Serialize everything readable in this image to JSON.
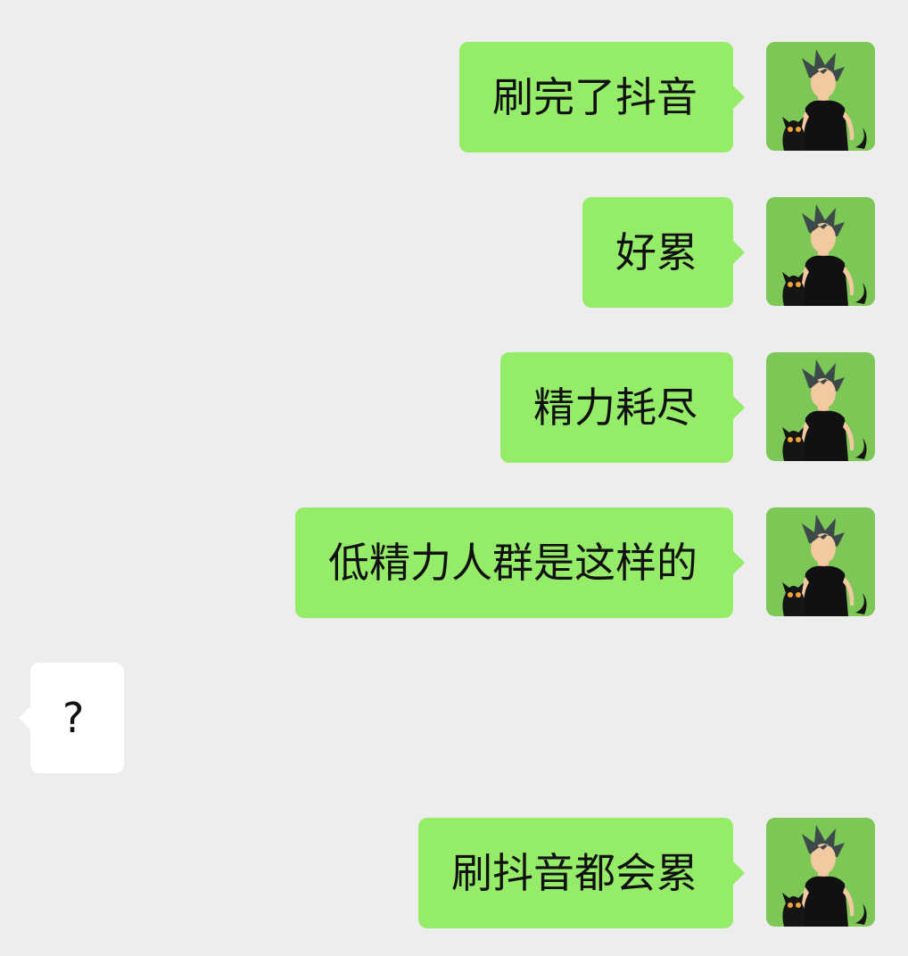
{
  "conversation": {
    "messages": [
      {
        "side": "sent",
        "text": "刷完了抖音"
      },
      {
        "side": "sent",
        "text": "好累"
      },
      {
        "side": "sent",
        "text": "精力耗尽"
      },
      {
        "side": "sent",
        "text": "低精力人群是这样的"
      },
      {
        "side": "received",
        "text": "?"
      },
      {
        "side": "sent",
        "text": "刷抖音都会累"
      }
    ],
    "avatar_icon": "anime-boy-with-black-cat-avatar",
    "colors": {
      "background": "#ededed",
      "sent_bubble": "#95ec69",
      "received_bubble": "#ffffff",
      "text": "#111111"
    }
  }
}
